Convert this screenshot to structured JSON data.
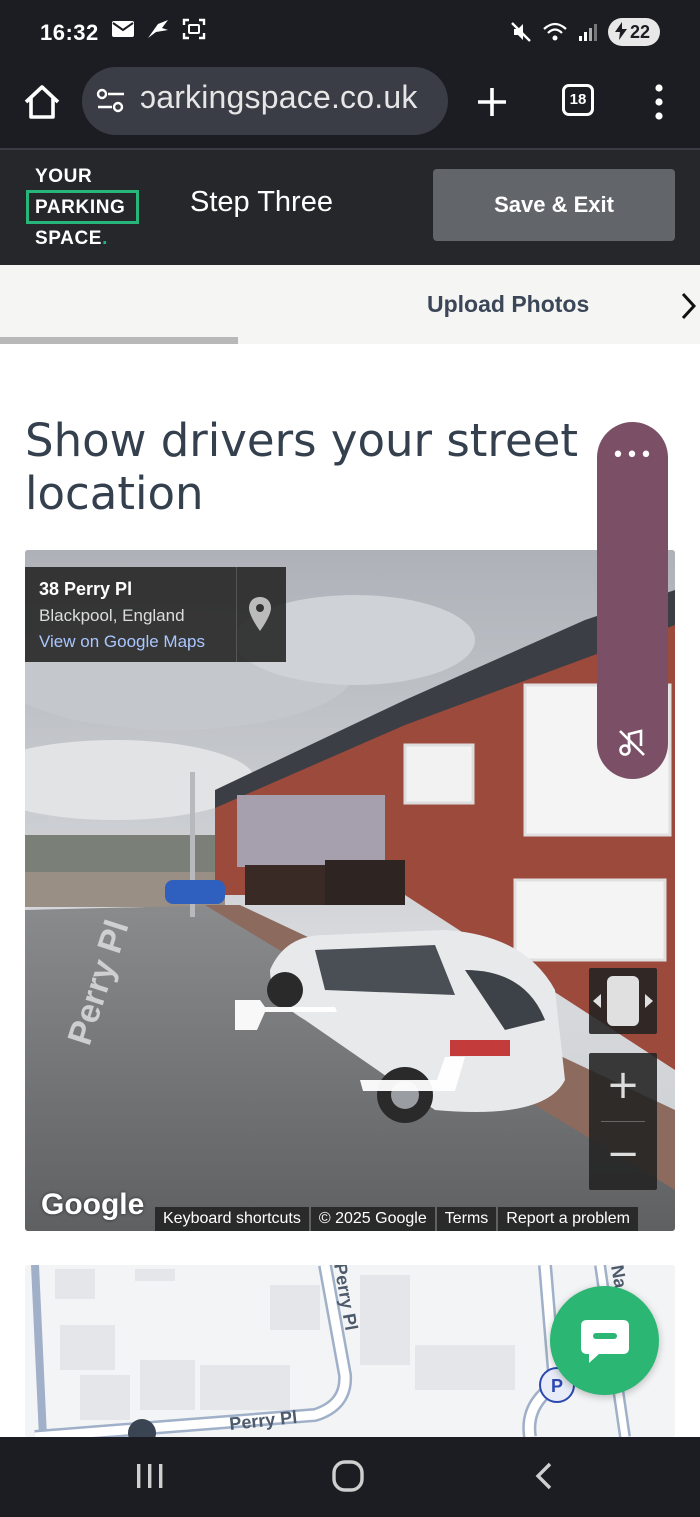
{
  "status_bar": {
    "time": "16:32",
    "battery": "22",
    "icons_left": [
      "mail-icon",
      "bird-icon",
      "screenshot-icon"
    ],
    "icons_right": [
      "mute-icon",
      "wifi-icon",
      "signal-icon",
      "battery-icon"
    ]
  },
  "browser": {
    "url": "parkingspace.co.uk",
    "url_visible": "ɔarkingspace.co.uk",
    "tab_count": "18",
    "icons": [
      "home-icon",
      "site-settings-icon",
      "new-tab-icon",
      "tabs-icon",
      "menu-icon"
    ]
  },
  "header": {
    "logo_line1": "YOUR",
    "logo_line2": "PARKING",
    "logo_line3": "SPACE",
    "logo_dot": ".",
    "step_title": "Step Three",
    "save_exit_label": "Save & Exit",
    "accent_color": "#27b67a"
  },
  "progress": {
    "label": "Upload Photos",
    "fraction": 0.34
  },
  "main": {
    "heading": "Show drivers your street location"
  },
  "street_view": {
    "address": "38 Perry Pl",
    "city": "Blackpool, England",
    "maps_link": "View on Google Maps",
    "street_label": "Perry Pl",
    "google_logo": "Google",
    "zoom_in": "+",
    "zoom_out": "−",
    "footer": {
      "shortcuts": "Keyboard shortcuts",
      "copyright": "© 2025 Google",
      "terms": "Terms",
      "report": "Report a problem"
    }
  },
  "floating": {
    "more_label": "•••"
  },
  "map": {
    "street_vertical": "Perry Pl",
    "street_horizontal": "Perry Pl",
    "street_partial": "Na",
    "parking_marker": "P"
  },
  "colors": {
    "chat_button": "#2bb673",
    "floating_panel": "#7b4f66",
    "heading": "#35404f"
  }
}
